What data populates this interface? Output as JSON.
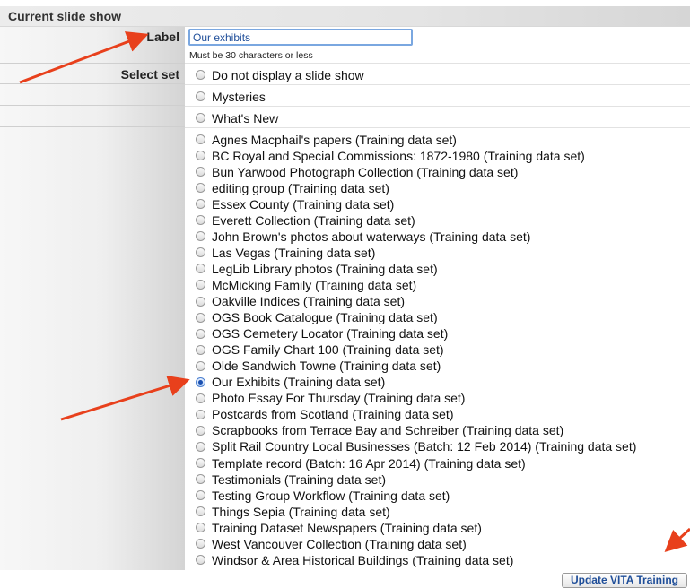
{
  "section_title": "Current slide show",
  "label_field": {
    "label": "Label",
    "value": "Our exhibits",
    "help": "Must be 30 characters or less"
  },
  "select_set_label": "Select set",
  "options_primary": [
    {
      "text": "Do not display a slide show",
      "checked": false
    },
    {
      "text": "Mysteries",
      "checked": false
    },
    {
      "text": "What's New",
      "checked": false
    }
  ],
  "options_training": [
    {
      "text": "Agnes Macphail's papers (Training data set)",
      "checked": false
    },
    {
      "text": "BC Royal and Special Commissions: 1872-1980 (Training data set)",
      "checked": false
    },
    {
      "text": "Bun Yarwood Photograph Collection (Training data set)",
      "checked": false
    },
    {
      "text": "editing group (Training data set)",
      "checked": false
    },
    {
      "text": "Essex County (Training data set)",
      "checked": false
    },
    {
      "text": "Everett Collection (Training data set)",
      "checked": false
    },
    {
      "text": "John Brown's photos about waterways (Training data set)",
      "checked": false
    },
    {
      "text": "Las Vegas (Training data set)",
      "checked": false
    },
    {
      "text": "LegLib Library photos (Training data set)",
      "checked": false
    },
    {
      "text": "McMicking Family (Training data set)",
      "checked": false
    },
    {
      "text": "Oakville Indices (Training data set)",
      "checked": false
    },
    {
      "text": "OGS Book Catalogue (Training data set)",
      "checked": false
    },
    {
      "text": "OGS Cemetery Locator (Training data set)",
      "checked": false
    },
    {
      "text": "OGS Family Chart 100 (Training data set)",
      "checked": false
    },
    {
      "text": "Olde Sandwich Towne (Training data set)",
      "checked": false
    },
    {
      "text": "Our Exhibits (Training data set)",
      "checked": true
    },
    {
      "text": "Photo Essay For Thursday (Training data set)",
      "checked": false
    },
    {
      "text": "Postcards from Scotland (Training data set)",
      "checked": false
    },
    {
      "text": "Scrapbooks from Terrace Bay and Schreiber (Training data set)",
      "checked": false
    },
    {
      "text": "Split Rail Country Local Businesses (Batch: 12 Feb 2014) (Training data set)",
      "checked": false
    },
    {
      "text": "Template record (Batch: 16 Apr 2014) (Training data set)",
      "checked": false
    },
    {
      "text": "Testimonials (Training data set)",
      "checked": false
    },
    {
      "text": "Testing Group Workflow (Training data set)",
      "checked": false
    },
    {
      "text": "Things Sepia (Training data set)",
      "checked": false
    },
    {
      "text": "Training Dataset Newspapers (Training data set)",
      "checked": false
    },
    {
      "text": "West Vancouver Collection (Training data set)",
      "checked": false
    },
    {
      "text": "Windsor & Area Historical Buildings (Training data set)",
      "checked": false
    }
  ],
  "update_button": "Update VITA Training",
  "colors": {
    "annotation_arrow": "#e8401c",
    "input_border": "#7aa7e0",
    "link_blue": "#1f4e99"
  }
}
